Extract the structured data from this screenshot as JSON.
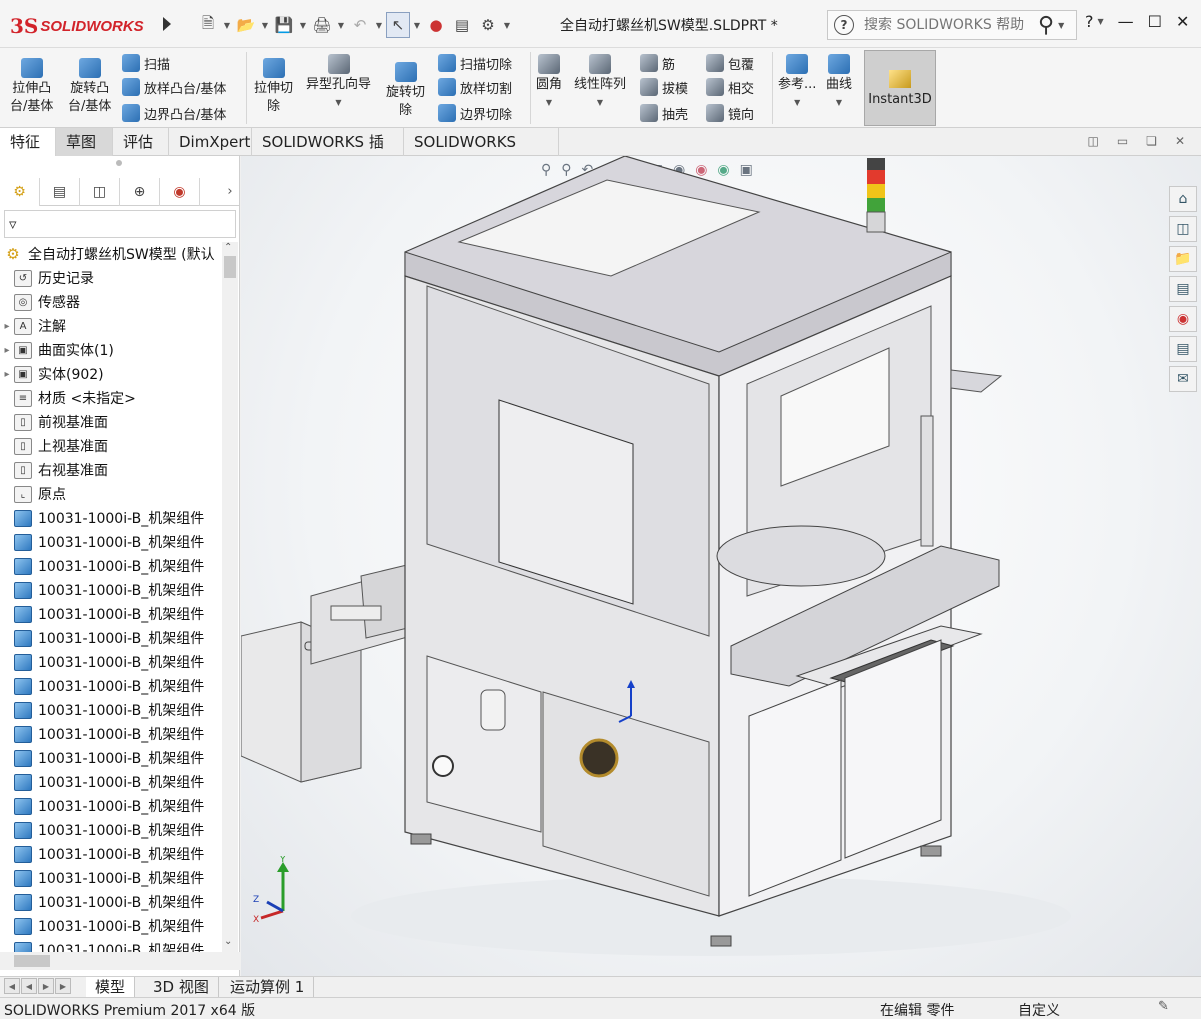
{
  "app": {
    "logo_ds": "3S",
    "logo_text": "SOLIDWORKS",
    "document_title": "全自动打螺丝机SW模型.SLDPRT *",
    "search_placeholder": "搜索 SOLIDWORKS 帮助",
    "help_label": "?"
  },
  "quick_access": [
    "new-icon",
    "open-icon",
    "save-icon",
    "print-icon",
    "undo-icon",
    "select-icon",
    "rebuild-icon",
    "file-properties-icon",
    "options-icon"
  ],
  "command_manager": {
    "extrude_boss": [
      "拉伸凸",
      "台/基体"
    ],
    "revolve_boss": [
      "旋转凸",
      "台/基体"
    ],
    "sweep": "扫描",
    "loft_boss": "放样凸台/基体",
    "boundary_boss": "边界凸台/基体",
    "extrude_cut": [
      "拉伸切",
      "除"
    ],
    "hole_wizard": "异型孔向导",
    "revolve_cut": [
      "旋转切",
      "除"
    ],
    "swept_cut": "扫描切除",
    "lofted_cut": "放样切割",
    "boundary_cut": "边界切除",
    "fillet": "圆角",
    "linear_pattern": "线性阵列",
    "rib": "筋",
    "draft": "拔模",
    "shell": "抽壳",
    "wrap": "包覆",
    "intersect": "相交",
    "mirror": "镜向",
    "reference": "参考...",
    "curves": "曲线",
    "instant3d": "Instant3D"
  },
  "tabs": [
    "特征",
    "草图",
    "评估",
    "DimXpert",
    "SOLIDWORKS 插件",
    "SOLIDWORKS MBD"
  ],
  "feature_tree": {
    "root": "全自动打螺丝机SW模型 (默认",
    "items": [
      {
        "label": "历史记录",
        "icon": "history-icon",
        "expandable": false
      },
      {
        "label": "传感器",
        "icon": "sensor-icon",
        "expandable": false
      },
      {
        "label": "注解",
        "icon": "annotation-icon",
        "expandable": true
      },
      {
        "label": "曲面实体(1)",
        "icon": "surface-bodies-icon",
        "expandable": true
      },
      {
        "label": "实体(902)",
        "icon": "solid-bodies-icon",
        "expandable": true
      },
      {
        "label": "材质 <未指定>",
        "icon": "material-icon",
        "expandable": false
      },
      {
        "label": "前视基准面",
        "icon": "plane-icon",
        "expandable": false
      },
      {
        "label": "上视基准面",
        "icon": "plane-icon",
        "expandable": false
      },
      {
        "label": "右视基准面",
        "icon": "plane-icon",
        "expandable": false
      },
      {
        "label": "原点",
        "icon": "origin-icon",
        "expandable": false
      }
    ],
    "part_label": "10031-1000i-B_机架组件",
    "part_count": 19
  },
  "bottom_tabs": [
    "模型",
    "3D 视图",
    "运动算例 1"
  ],
  "status": {
    "left": "SOLIDWORKS Premium 2017 x64 版",
    "mode": "在编辑 零件",
    "units": "自定义"
  },
  "colors": {
    "brand_red": "#d2232a",
    "machine_body": "#e6e6e8",
    "machine_frame": "#d7d6dc",
    "viewport_bg": "#f2f4f6"
  }
}
